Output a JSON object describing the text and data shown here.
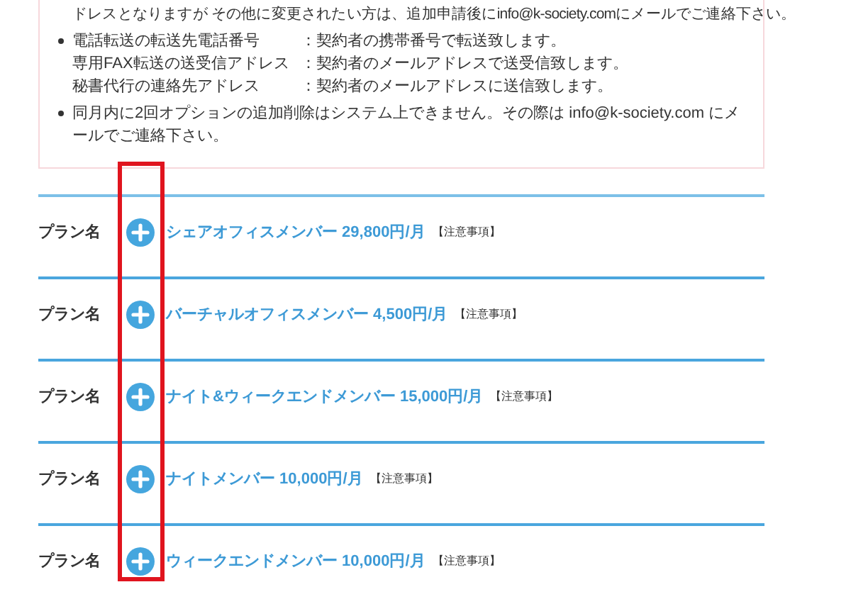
{
  "notice": {
    "continued_line": "ドレスとなりますが その他に変更されたい方は、追加申請後にinfo@k-society.comにメールでご連絡下さい。",
    "bullets": [
      {
        "kind": "pairs",
        "pairs": [
          {
            "label": "電話転送の転送先電話番号",
            "value": "：契約者の携帯番号で転送致します。"
          },
          {
            "label": "専用FAX転送の送受信アドレス",
            "value": "：契約者のメールアドレスで送受信致します。"
          },
          {
            "label": "秘書代行の連絡先アドレス",
            "value": "：契約者のメールアドレスに送信致します。"
          }
        ]
      },
      {
        "kind": "text",
        "text": "同月内に2回オプションの追加削除はシステム上できません。その際は info@k-society.com にメールでご連絡下さい。"
      }
    ]
  },
  "plans": [
    {
      "label": "プラン名",
      "name": "シェアオフィスメンバー 29,800円/月",
      "note": "【注意事項】"
    },
    {
      "label": "プラン名",
      "name": "バーチャルオフィスメンバー 4,500円/月",
      "note": "【注意事項】"
    },
    {
      "label": "プラン名",
      "name": "ナイト&ウィークエンドメンバー 15,000円/月",
      "note": "【注意事項】"
    },
    {
      "label": "プラン名",
      "name": "ナイトメンバー 10,000円/月",
      "note": "【注意事項】"
    },
    {
      "label": "プラン名",
      "name": "ウィークエンドメンバー 10,000円/月",
      "note": "【注意事項】"
    }
  ]
}
